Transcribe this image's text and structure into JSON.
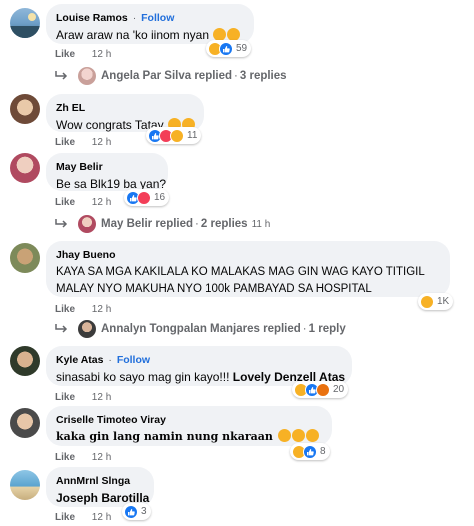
{
  "comments": [
    {
      "author": "Louise Ramos",
      "follow": "Follow",
      "text": "Araw araw na 'ko iinom nyan",
      "like": "Like",
      "time": "12 h",
      "reaction_count": "59",
      "replies": {
        "label": "Angela Par Silva replied",
        "count": "3 replies",
        "time": ""
      }
    },
    {
      "author": "Zh EL",
      "text": "Wow congrats Tatay",
      "like": "Like",
      "time": "12 h",
      "reaction_count": "11"
    },
    {
      "author": "May Belir",
      "text": "Be sa Blk19 ba yan?",
      "like": "Like",
      "time": "12 h",
      "reaction_count": "16",
      "replies": {
        "label": "May Belir replied",
        "count": "2 replies",
        "time": "11 h"
      }
    },
    {
      "author": "Jhay Bueno",
      "text_line1": "KAYA SA MGA KAKILALA KO MALAKAS MAG GIN WAG KAYO TITIGIL",
      "text_line2": "MALAY NYO MAKUHA NYO 100k PAMBAYAD SA HOSPITAL",
      "like": "Like",
      "time": "12 h",
      "reaction_count": "1K",
      "replies": {
        "label": "Annalyn Tongpalan Manjares replied",
        "count": "1 reply",
        "time": ""
      }
    },
    {
      "author": "Kyle Atas",
      "follow": "Follow",
      "text": "sinasabi ko sayo mag gin kayo!!!",
      "mention": "Lovely Denzell Atas",
      "like": "Like",
      "time": "12 h",
      "reaction_count": "20"
    },
    {
      "author": "Criselle Timoteo Viray",
      "text": "kaka gin lang namin nung nkaraan",
      "like": "Like",
      "time": "12 h",
      "reaction_count": "8"
    },
    {
      "author": "AnnMrnl Slnga",
      "text": "Joseph Barotilla",
      "like": "Like",
      "time": "12 h",
      "reaction_count": "3"
    }
  ],
  "separator": "·",
  "colors": {
    "like": "#1877f2",
    "love": "#f33e58",
    "haha": "#f7b125",
    "angry": "#e9710f",
    "follow": "#216fdb"
  }
}
